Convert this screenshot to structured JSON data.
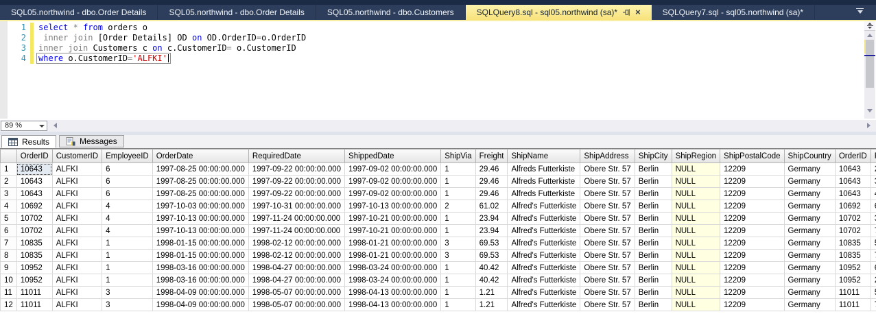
{
  "window": {
    "tabs": [
      {
        "label": "SQL05.northwind - dbo.Order Details",
        "active": false
      },
      {
        "label": "SQL05.northwind - dbo.Order Details",
        "active": false
      },
      {
        "label": "SQL05.northwind - dbo.Customers",
        "active": false
      },
      {
        "label": "SQLQuery8.sql - sql05.northwind (sa)*",
        "active": true,
        "icons": [
          "pin-icon",
          "close-icon"
        ]
      },
      {
        "label": "SQLQuery7.sql - sql05.northwind (sa)*",
        "active": false
      }
    ],
    "active_tab_color": "#F8E27C",
    "tabbar_color": "#2C3E5C"
  },
  "editor": {
    "zoom_value": "89 %",
    "lines": [
      {
        "number": "1",
        "modified": true,
        "tokens": [
          {
            "t": "select",
            "c": "kw"
          },
          {
            "t": " ",
            "c": "pl"
          },
          {
            "t": "*",
            "c": "op"
          },
          {
            "t": " ",
            "c": "pl"
          },
          {
            "t": "from",
            "c": "kw"
          },
          {
            "t": " orders o",
            "c": "pl"
          }
        ]
      },
      {
        "number": "2",
        "modified": true,
        "tokens": [
          {
            "t": " ",
            "c": "pl"
          },
          {
            "t": "inner join",
            "c": "op"
          },
          {
            "t": " [Order Details] OD ",
            "c": "pl"
          },
          {
            "t": "on",
            "c": "kw"
          },
          {
            "t": " OD.OrderID",
            "c": "pl"
          },
          {
            "t": "=",
            "c": "op"
          },
          {
            "t": "o.OrderID",
            "c": "pl"
          }
        ]
      },
      {
        "number": "3",
        "modified": true,
        "tokens": [
          {
            "t": "inner join",
            "c": "op"
          },
          {
            "t": " Customers c ",
            "c": "pl"
          },
          {
            "t": "on",
            "c": "kw"
          },
          {
            "t": " c.CustomerID",
            "c": "pl"
          },
          {
            "t": "=",
            "c": "op"
          },
          {
            "t": " o.CustomerID",
            "c": "pl"
          }
        ]
      },
      {
        "number": "4",
        "modified": true,
        "current": true,
        "caret": true,
        "tokens": [
          {
            "t": "where",
            "c": "kw"
          },
          {
            "t": " o.CustomerID",
            "c": "pl"
          },
          {
            "t": "=",
            "c": "op"
          },
          {
            "t": "'ALFKI'",
            "c": "str"
          }
        ]
      }
    ],
    "syntax_colors": {
      "keyword": "#0000E8",
      "operator": "#7F7F7F",
      "string": "#CE0000",
      "plain": "#000000",
      "line_number": "#2B91AF"
    }
  },
  "results_pane": {
    "tabs": [
      {
        "label": "Results",
        "icon": "results-grid-icon",
        "active": true
      },
      {
        "label": "Messages",
        "icon": "messages-icon",
        "active": false
      }
    ]
  },
  "grid": {
    "columns": [
      "OrderID",
      "CustomerID",
      "EmployeeID",
      "OrderDate",
      "RequiredDate",
      "ShippedDate",
      "ShipVia",
      "Freight",
      "ShipName",
      "ShipAddress",
      "ShipCity",
      "ShipRegion",
      "ShipPostalCode",
      "ShipCountry",
      "OrderID",
      "P"
    ],
    "selected_cell": {
      "row_index": 0,
      "col_index": 1
    },
    "null_background": "#FFFFE1",
    "rows": [
      [
        "1",
        "10643",
        "ALFKI",
        "6",
        "1997-08-25 00:00:00.000",
        "1997-09-22 00:00:00.000",
        "1997-09-02 00:00:00.000",
        "1",
        "29.46",
        "Alfreds Futterkiste",
        "Obere Str. 57",
        "Berlin",
        "NULL",
        "12209",
        "Germany",
        "10643",
        "2"
      ],
      [
        "2",
        "10643",
        "ALFKI",
        "6",
        "1997-08-25 00:00:00.000",
        "1997-09-22 00:00:00.000",
        "1997-09-02 00:00:00.000",
        "1",
        "29.46",
        "Alfreds Futterkiste",
        "Obere Str. 57",
        "Berlin",
        "NULL",
        "12209",
        "Germany",
        "10643",
        "3"
      ],
      [
        "3",
        "10643",
        "ALFKI",
        "6",
        "1997-08-25 00:00:00.000",
        "1997-09-22 00:00:00.000",
        "1997-09-02 00:00:00.000",
        "1",
        "29.46",
        "Alfreds Futterkiste",
        "Obere Str. 57",
        "Berlin",
        "NULL",
        "12209",
        "Germany",
        "10643",
        "4"
      ],
      [
        "4",
        "10692",
        "ALFKI",
        "4",
        "1997-10-03 00:00:00.000",
        "1997-10-31 00:00:00.000",
        "1997-10-13 00:00:00.000",
        "2",
        "61.02",
        "Alfred's Futterkiste",
        "Obere Str. 57",
        "Berlin",
        "NULL",
        "12209",
        "Germany",
        "10692",
        "6"
      ],
      [
        "5",
        "10702",
        "ALFKI",
        "4",
        "1997-10-13 00:00:00.000",
        "1997-11-24 00:00:00.000",
        "1997-10-21 00:00:00.000",
        "1",
        "23.94",
        "Alfred's Futterkiste",
        "Obere Str. 57",
        "Berlin",
        "NULL",
        "12209",
        "Germany",
        "10702",
        "3"
      ],
      [
        "6",
        "10702",
        "ALFKI",
        "4",
        "1997-10-13 00:00:00.000",
        "1997-11-24 00:00:00.000",
        "1997-10-21 00:00:00.000",
        "1",
        "23.94",
        "Alfred's Futterkiste",
        "Obere Str. 57",
        "Berlin",
        "NULL",
        "12209",
        "Germany",
        "10702",
        "7"
      ],
      [
        "7",
        "10835",
        "ALFKI",
        "1",
        "1998-01-15 00:00:00.000",
        "1998-02-12 00:00:00.000",
        "1998-01-21 00:00:00.000",
        "3",
        "69.53",
        "Alfred's Futterkiste",
        "Obere Str. 57",
        "Berlin",
        "NULL",
        "12209",
        "Germany",
        "10835",
        "5"
      ],
      [
        "8",
        "10835",
        "ALFKI",
        "1",
        "1998-01-15 00:00:00.000",
        "1998-02-12 00:00:00.000",
        "1998-01-21 00:00:00.000",
        "3",
        "69.53",
        "Alfred's Futterkiste",
        "Obere Str. 57",
        "Berlin",
        "NULL",
        "12209",
        "Germany",
        "10835",
        "7"
      ],
      [
        "9",
        "10952",
        "ALFKI",
        "1",
        "1998-03-16 00:00:00.000",
        "1998-04-27 00:00:00.000",
        "1998-03-24 00:00:00.000",
        "1",
        "40.42",
        "Alfred's Futterkiste",
        "Obere Str. 57",
        "Berlin",
        "NULL",
        "12209",
        "Germany",
        "10952",
        "6"
      ],
      [
        "10",
        "10952",
        "ALFKI",
        "1",
        "1998-03-16 00:00:00.000",
        "1998-04-27 00:00:00.000",
        "1998-03-24 00:00:00.000",
        "1",
        "40.42",
        "Alfred's Futterkiste",
        "Obere Str. 57",
        "Berlin",
        "NULL",
        "12209",
        "Germany",
        "10952",
        "2"
      ],
      [
        "11",
        "11011",
        "ALFKI",
        "3",
        "1998-04-09 00:00:00.000",
        "1998-05-07 00:00:00.000",
        "1998-04-13 00:00:00.000",
        "1",
        "1.21",
        "Alfred's Futterkiste",
        "Obere Str. 57",
        "Berlin",
        "NULL",
        "12209",
        "Germany",
        "11011",
        "5"
      ],
      [
        "12",
        "11011",
        "ALFKI",
        "3",
        "1998-04-09 00:00:00.000",
        "1998-05-07 00:00:00.000",
        "1998-04-13 00:00:00.000",
        "1",
        "1.21",
        "Alfred's Futterkiste",
        "Obere Str. 57",
        "Berlin",
        "NULL",
        "12209",
        "Germany",
        "11011",
        "7"
      ]
    ]
  }
}
